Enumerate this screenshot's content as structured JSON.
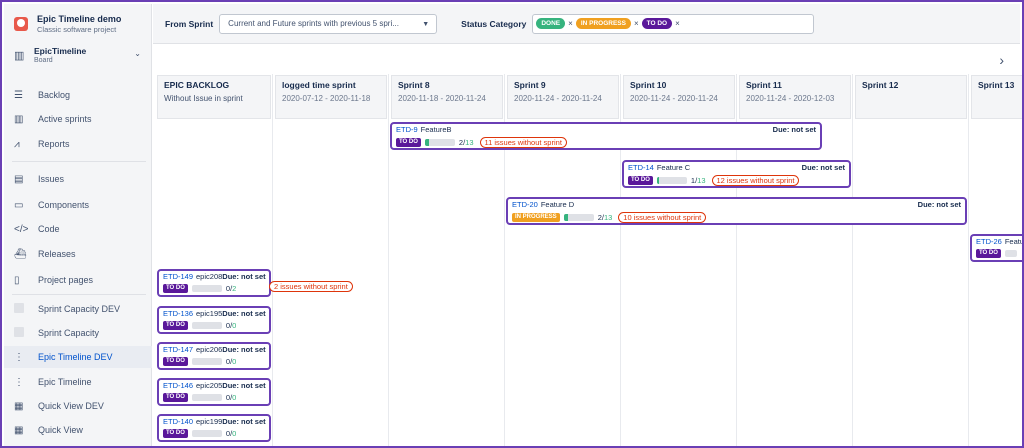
{
  "project": {
    "name": "Epic Timeline demo",
    "subtitle": "Classic software project"
  },
  "board": {
    "name": "EpicTimeline",
    "subtitle": "Board"
  },
  "nav": [
    {
      "label": "Backlog",
      "icon": "backlog-icon"
    },
    {
      "label": "Active sprints",
      "icon": "columns-icon"
    },
    {
      "label": "Reports",
      "icon": "chart-icon"
    },
    {
      "label": "Issues",
      "icon": "issues-icon"
    },
    {
      "label": "Components",
      "icon": "components-icon"
    },
    {
      "label": "Code",
      "icon": "code-icon"
    },
    {
      "label": "Releases",
      "icon": "ship-icon"
    },
    {
      "label": "Project pages",
      "icon": "page-icon"
    },
    {
      "label": "Sprint Capacity DEV",
      "icon": "app-icon"
    },
    {
      "label": "Sprint Capacity",
      "icon": "app-icon"
    },
    {
      "label": "Epic Timeline DEV",
      "icon": "timeline-icon",
      "active": true
    },
    {
      "label": "Epic Timeline",
      "icon": "timeline-icon"
    },
    {
      "label": "Quick View DEV",
      "icon": "quickview-icon"
    },
    {
      "label": "Quick View",
      "icon": "quickview-icon"
    }
  ],
  "filters": {
    "from_sprint_label": "From Sprint",
    "from_sprint_value": "Current and Future sprints with previous 5 spri...",
    "status_label": "Status Category",
    "chips": [
      {
        "label": "DONE",
        "color": "#36b37e"
      },
      {
        "label": "IN PROGRESS",
        "color": "#f0a020"
      },
      {
        "label": "TO DO",
        "color": "#5a189a"
      }
    ],
    "x": "×"
  },
  "nav_arrow": "›",
  "columns": [
    {
      "title": "EPIC BACKLOG",
      "dates": "Without Issue in sprint"
    },
    {
      "title": "logged time sprint",
      "dates": "2020-07-12 - 2020-11-18"
    },
    {
      "title": "Sprint 8",
      "dates": "2020-11-18 - 2020-11-24"
    },
    {
      "title": "Sprint 9",
      "dates": "2020-11-24 - 2020-11-24"
    },
    {
      "title": "Sprint 10",
      "dates": "2020-11-24 - 2020-11-24"
    },
    {
      "title": "Sprint 11",
      "dates": "2020-11-24 - 2020-12-03"
    },
    {
      "title": "Sprint 12",
      "dates": ""
    },
    {
      "title": "Sprint 13",
      "dates": ""
    }
  ],
  "epics": [
    {
      "key": "ETD-9",
      "name": "FeatureB",
      "due": "Due: not set",
      "status": "TO DO",
      "done": "2",
      "total": "13",
      "progress": 0.15,
      "warning": "11 issues without sprint"
    },
    {
      "key": "ETD-14",
      "name": "Feature C",
      "due": "Due: not set",
      "status": "TO DO",
      "done": "1",
      "total": "13",
      "progress": 0.08,
      "warning": "12 issues without sprint"
    },
    {
      "key": "ETD-20",
      "name": "Feature D",
      "due": "Due: not set",
      "status": "IN PROGRESS",
      "done": "2",
      "total": "13",
      "progress": 0.15,
      "warning": "10 issues without sprint"
    },
    {
      "key": "ETD-26",
      "name": "Feature",
      "due": "",
      "status": "TO DO",
      "done": "",
      "total": "",
      "progress": 0,
      "warning": ""
    },
    {
      "key": "ETD-149",
      "name": "epic208",
      "due": "Due: not set",
      "status": "TO DO",
      "done": "0",
      "total": "2",
      "progress": 0,
      "warning": "2 issues without sprint"
    },
    {
      "key": "ETD-136",
      "name": "epic195",
      "due": "Due: not set",
      "status": "TO DO",
      "done": "0",
      "total": "0",
      "progress": 0,
      "warning": ""
    },
    {
      "key": "ETD-147",
      "name": "epic206",
      "due": "Due: not set",
      "status": "TO DO",
      "done": "0",
      "total": "0",
      "progress": 0,
      "warning": ""
    },
    {
      "key": "ETD-146",
      "name": "epic205",
      "due": "Due: not set",
      "status": "TO DO",
      "done": "0",
      "total": "0",
      "progress": 0,
      "warning": ""
    },
    {
      "key": "ETD-140",
      "name": "epic199",
      "due": "Due: not set",
      "status": "TO DO",
      "done": "0",
      "total": "0",
      "progress": 0,
      "warning": ""
    }
  ]
}
